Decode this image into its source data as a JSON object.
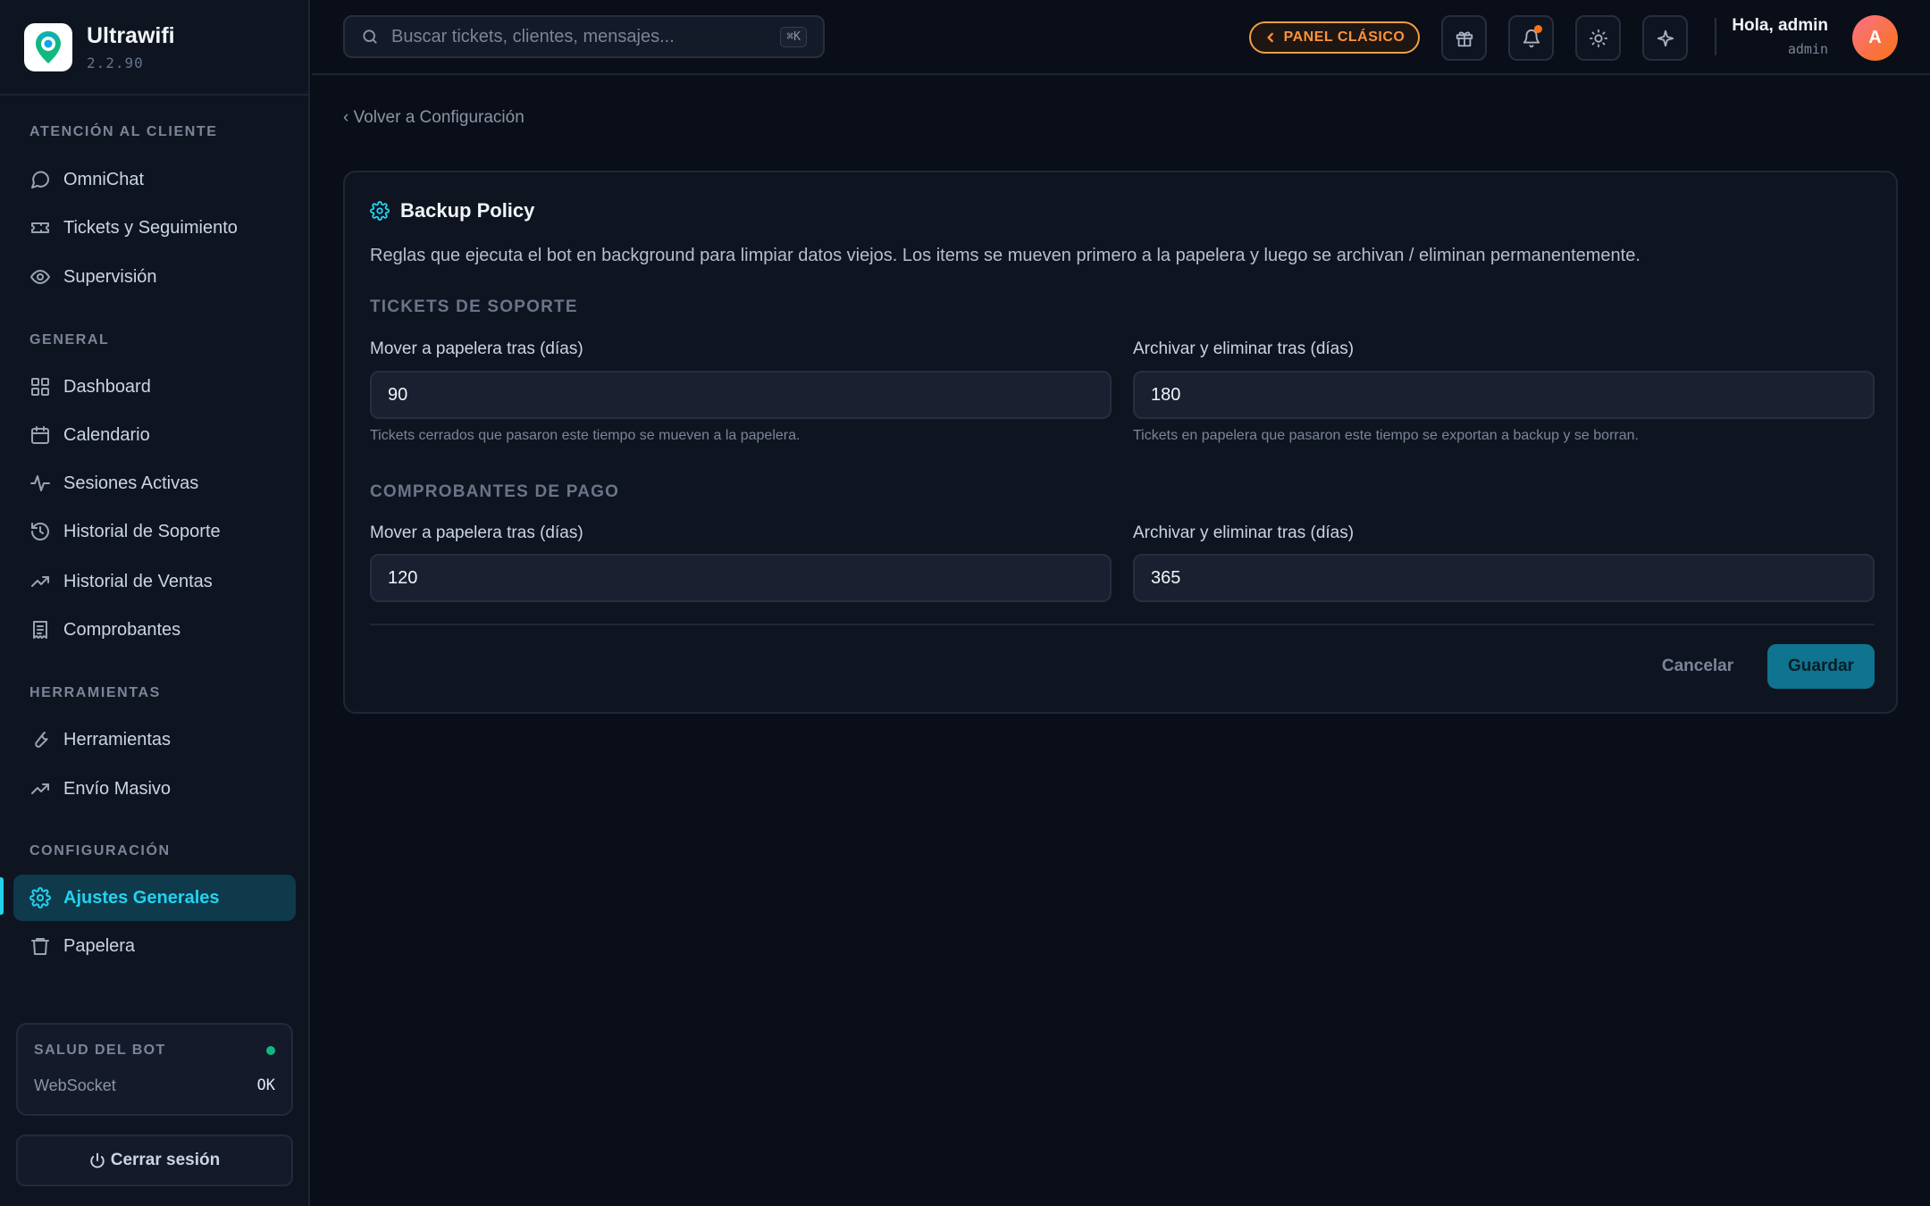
{
  "brand": {
    "name": "Ultrawifi",
    "version": "2.2.90",
    "logo_icon": "location-pin-wifi-logo"
  },
  "sidebar": {
    "sections": [
      {
        "title": "ATENCIÓN AL CLIENTE",
        "items": [
          {
            "label": "OmniChat",
            "icon": "chat-bubble-icon"
          },
          {
            "label": "Tickets y Seguimiento",
            "icon": "ticket-icon"
          },
          {
            "label": "Supervisión",
            "icon": "eye-icon"
          }
        ]
      },
      {
        "title": "GENERAL",
        "items": [
          {
            "label": "Dashboard",
            "icon": "grid-icon"
          },
          {
            "label": "Calendario",
            "icon": "calendar-icon"
          },
          {
            "label": "Sesiones Activas",
            "icon": "activity-icon"
          },
          {
            "label": "Historial de Soporte",
            "icon": "history-icon"
          },
          {
            "label": "Historial de Ventas",
            "icon": "trending-up-icon"
          },
          {
            "label": "Comprobantes",
            "icon": "receipt-icon"
          }
        ]
      },
      {
        "title": "HERRAMIENTAS",
        "items": [
          {
            "label": "Herramientas",
            "icon": "wrench-icon"
          },
          {
            "label": "Envío Masivo",
            "icon": "trending-up-icon"
          }
        ]
      },
      {
        "title": "CONFIGURACIÓN",
        "items": [
          {
            "label": "Ajustes Generales",
            "icon": "gear-icon",
            "active": true
          },
          {
            "label": "Papelera",
            "icon": "trash-icon"
          }
        ]
      }
    ],
    "health": {
      "title": "SALUD DEL BOT",
      "status_color": "#10b981",
      "row_label": "WebSocket",
      "row_value": "OK"
    },
    "logout_label": "Cerrar sesión"
  },
  "topbar": {
    "search_placeholder": "Buscar tickets, clientes, mensajes...",
    "search_shortcut": "⌘K",
    "classic_panel_label": "PANEL CLÁSICO",
    "greeting": "Hola, admin",
    "role": "admin",
    "avatar_initial": "A"
  },
  "main": {
    "back_label": "‹ Volver a Configuración",
    "card": {
      "title": "Backup Policy",
      "description": "Reglas que ejecuta el bot en background para limpiar datos viejos. Los items se mueven primero a la papelera y luego se archivan / eliminan permanentemente.",
      "groups": [
        {
          "title": "TICKETS DE SOPORTE",
          "trash_label": "Mover a papelera tras (días)",
          "trash_value": "90",
          "trash_hint": "Tickets cerrados que pasaron este tiempo se mueven a la papelera.",
          "archive_label": "Archivar y eliminar tras (días)",
          "archive_value": "180",
          "archive_hint": "Tickets en papelera que pasaron este tiempo se exportan a backup y se borran."
        },
        {
          "title": "COMPROBANTES DE PAGO",
          "trash_label": "Mover a papelera tras (días)",
          "trash_value": "120",
          "archive_label": "Archivar y eliminar tras (días)",
          "archive_value": "365"
        }
      ],
      "cancel_label": "Cancelar",
      "save_label": "Guardar"
    }
  },
  "colors": {
    "accent": "#22d3ee",
    "warning": "#f59e42",
    "background": "#0a0e18"
  }
}
